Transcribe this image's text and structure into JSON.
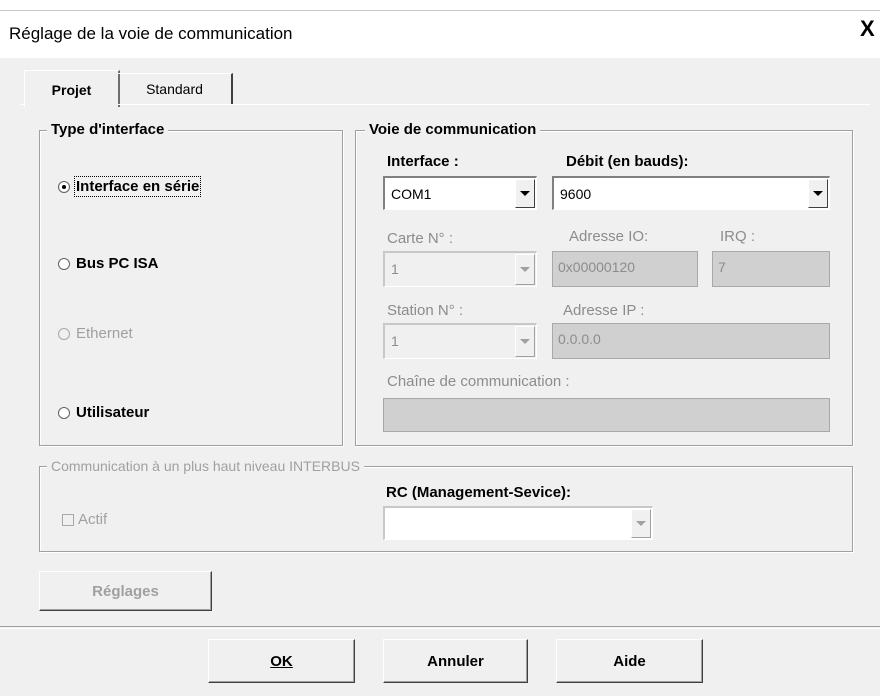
{
  "window": {
    "title": "Réglage de la voie de communication",
    "close_glyph": "X"
  },
  "tabs": [
    {
      "label": "Projet",
      "active": true
    },
    {
      "label": "Standard",
      "active": false
    }
  ],
  "interface_type": {
    "legend": "Type d'interface",
    "options": [
      {
        "label": "Interface en série",
        "selected": true,
        "enabled": true,
        "accesskey": "I"
      },
      {
        "label": "Bus PC ISA",
        "selected": false,
        "enabled": true,
        "accesskey": "B"
      },
      {
        "label": "Ethernet",
        "selected": false,
        "enabled": false,
        "accesskey": "E"
      },
      {
        "label": "Utilisateur",
        "selected": false,
        "enabled": true,
        "accesskey": "U"
      }
    ]
  },
  "comm_channel": {
    "legend": "Voie de communication",
    "interface": {
      "label": "Interface :",
      "value": "COM1"
    },
    "baud_rate": {
      "label": "Débit (en bauds):",
      "value": "9600"
    },
    "card": {
      "label": "Carte N° :",
      "value": "1"
    },
    "io_address": {
      "label": "Adresse IO:",
      "value": "0x00000120"
    },
    "irq": {
      "label": "IRQ :",
      "value": "7"
    },
    "station": {
      "label": "Station N° :",
      "value": "1"
    },
    "ip_address": {
      "label": "Adresse IP :",
      "value": "0.0.0.0"
    },
    "comm_string": {
      "label": "Chaîne de communication :",
      "value": ""
    }
  },
  "interbus": {
    "legend": "Communication à un plus haut niveau INTERBUS",
    "actif": {
      "label": "Actif",
      "checked": false,
      "enabled": false
    },
    "rc": {
      "label": "RC (Management-Sevice):",
      "value": ""
    }
  },
  "buttons": {
    "settings": "Réglages",
    "ok": "OK",
    "cancel": "Annuler",
    "help": "Aide"
  }
}
